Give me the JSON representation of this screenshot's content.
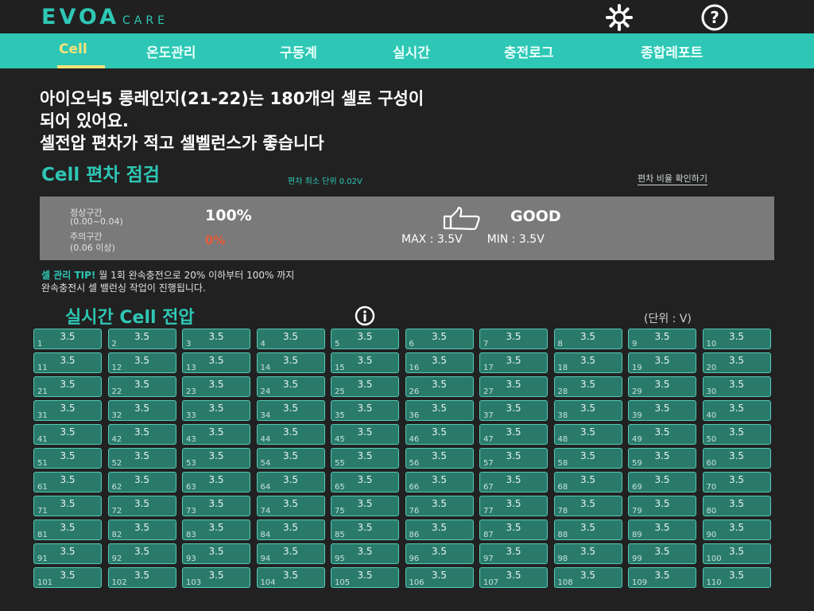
{
  "header": {
    "logo_main": "EVOA",
    "logo_sub": "CARE",
    "gear_icon": "gear-icon",
    "help_icon": "question-icon"
  },
  "tabs": [
    {
      "label": "Cell",
      "active": true
    },
    {
      "label": "온도관리",
      "active": false
    },
    {
      "label": "구동계",
      "active": false
    },
    {
      "label": "실시간",
      "active": false
    },
    {
      "label": "충전로그",
      "active": false
    },
    {
      "label": "종합레포트",
      "active": false
    }
  ],
  "summary": {
    "line1": "아이오닉5 롱레인지(21-22)는 180개의 셀로 구성이",
    "line2": "되어 있어요.",
    "line3": "셀전압 편차가 적고 셀벨런스가 좋습니다"
  },
  "deviation": {
    "title": "Cell 편차 점검",
    "subtitle": "편차 최소 단위 0.02V",
    "link": "편차 비율 확인하기",
    "normal_label_1": "정상구간",
    "normal_label_2": "(0.00~0.04)",
    "normal_value": "100%",
    "warn_label_1": "주의구간",
    "warn_label_2": "(0.06 이상)",
    "warn_value": "0%",
    "status": "GOOD",
    "max_label": "MAX : 3.5V",
    "min_label": "MIN : 3.5V"
  },
  "tip": {
    "prefix": "셀 관리 TIP!",
    "text1": " 월 1회 완속충전으로 20% 이하부터 100% 까지",
    "text2": "완속충전시 셀 밸런싱 작업이 진행됩니다."
  },
  "realtime": {
    "title": "실시간 Cell 전압",
    "unit": "(단위 : V)"
  },
  "colors": {
    "accent": "#2ec7b5",
    "background": "#212121",
    "active_tab": "#f6e27a",
    "cell": "#2a7a6c",
    "warn": "#e85a3a"
  },
  "cells": [
    {
      "n": "1",
      "v": "3.5"
    },
    {
      "n": "2",
      "v": "3.5"
    },
    {
      "n": "3",
      "v": "3.5"
    },
    {
      "n": "4",
      "v": "3.5"
    },
    {
      "n": "5",
      "v": "3.5"
    },
    {
      "n": "6",
      "v": "3.5"
    },
    {
      "n": "7",
      "v": "3.5"
    },
    {
      "n": "8",
      "v": "3.5"
    },
    {
      "n": "9",
      "v": "3.5"
    },
    {
      "n": "10",
      "v": "3.5"
    },
    {
      "n": "11",
      "v": "3.5"
    },
    {
      "n": "12",
      "v": "3.5"
    },
    {
      "n": "13",
      "v": "3.5"
    },
    {
      "n": "14",
      "v": "3.5"
    },
    {
      "n": "15",
      "v": "3.5"
    },
    {
      "n": "16",
      "v": "3.5"
    },
    {
      "n": "17",
      "v": "3.5"
    },
    {
      "n": "18",
      "v": "3.5"
    },
    {
      "n": "19",
      "v": "3.5"
    },
    {
      "n": "20",
      "v": "3.5"
    },
    {
      "n": "21",
      "v": "3.5"
    },
    {
      "n": "22",
      "v": "3.5"
    },
    {
      "n": "23",
      "v": "3.5"
    },
    {
      "n": "24",
      "v": "3.5"
    },
    {
      "n": "25",
      "v": "3.5"
    },
    {
      "n": "26",
      "v": "3.5"
    },
    {
      "n": "27",
      "v": "3.5"
    },
    {
      "n": "28",
      "v": "3.5"
    },
    {
      "n": "29",
      "v": "3.5"
    },
    {
      "n": "30",
      "v": "3.5"
    },
    {
      "n": "31",
      "v": "3.5"
    },
    {
      "n": "32",
      "v": "3.5"
    },
    {
      "n": "33",
      "v": "3.5"
    },
    {
      "n": "34",
      "v": "3.5"
    },
    {
      "n": "35",
      "v": "3.5"
    },
    {
      "n": "36",
      "v": "3.5"
    },
    {
      "n": "37",
      "v": "3.5"
    },
    {
      "n": "38",
      "v": "3.5"
    },
    {
      "n": "39",
      "v": "3.5"
    },
    {
      "n": "40",
      "v": "3.5"
    },
    {
      "n": "41",
      "v": "3.5"
    },
    {
      "n": "42",
      "v": "3.5"
    },
    {
      "n": "43",
      "v": "3.5"
    },
    {
      "n": "44",
      "v": "3.5"
    },
    {
      "n": "45",
      "v": "3.5"
    },
    {
      "n": "46",
      "v": "3.5"
    },
    {
      "n": "47",
      "v": "3.5"
    },
    {
      "n": "48",
      "v": "3.5"
    },
    {
      "n": "49",
      "v": "3.5"
    },
    {
      "n": "50",
      "v": "3.5"
    },
    {
      "n": "51",
      "v": "3.5"
    },
    {
      "n": "52",
      "v": "3.5"
    },
    {
      "n": "53",
      "v": "3.5"
    },
    {
      "n": "54",
      "v": "3.5"
    },
    {
      "n": "55",
      "v": "3.5"
    },
    {
      "n": "56",
      "v": "3.5"
    },
    {
      "n": "57",
      "v": "3.5"
    },
    {
      "n": "58",
      "v": "3.5"
    },
    {
      "n": "59",
      "v": "3.5"
    },
    {
      "n": "60",
      "v": "3.5"
    },
    {
      "n": "61",
      "v": "3.5"
    },
    {
      "n": "62",
      "v": "3.5"
    },
    {
      "n": "63",
      "v": "3.5"
    },
    {
      "n": "64",
      "v": "3.5"
    },
    {
      "n": "65",
      "v": "3.5"
    },
    {
      "n": "66",
      "v": "3.5"
    },
    {
      "n": "67",
      "v": "3.5"
    },
    {
      "n": "68",
      "v": "3.5"
    },
    {
      "n": "69",
      "v": "3.5"
    },
    {
      "n": "70",
      "v": "3.5"
    },
    {
      "n": "71",
      "v": "3.5"
    },
    {
      "n": "72",
      "v": "3.5"
    },
    {
      "n": "73",
      "v": "3.5"
    },
    {
      "n": "74",
      "v": "3.5"
    },
    {
      "n": "75",
      "v": "3.5"
    },
    {
      "n": "76",
      "v": "3.5"
    },
    {
      "n": "77",
      "v": "3.5"
    },
    {
      "n": "78",
      "v": "3.5"
    },
    {
      "n": "79",
      "v": "3.5"
    },
    {
      "n": "80",
      "v": "3.5"
    },
    {
      "n": "81",
      "v": "3.5"
    },
    {
      "n": "82",
      "v": "3.5"
    },
    {
      "n": "83",
      "v": "3.5"
    },
    {
      "n": "84",
      "v": "3.5"
    },
    {
      "n": "85",
      "v": "3.5"
    },
    {
      "n": "86",
      "v": "3.5"
    },
    {
      "n": "87",
      "v": "3.5"
    },
    {
      "n": "88",
      "v": "3.5"
    },
    {
      "n": "89",
      "v": "3.5"
    },
    {
      "n": "90",
      "v": "3.5"
    },
    {
      "n": "91",
      "v": "3.5"
    },
    {
      "n": "92",
      "v": "3.5"
    },
    {
      "n": "93",
      "v": "3.5"
    },
    {
      "n": "94",
      "v": "3.5"
    },
    {
      "n": "95",
      "v": "3.5"
    },
    {
      "n": "96",
      "v": "3.5"
    },
    {
      "n": "97",
      "v": "3.5"
    },
    {
      "n": "98",
      "v": "3.5"
    },
    {
      "n": "99",
      "v": "3.5"
    },
    {
      "n": "100",
      "v": "3.5"
    },
    {
      "n": "101",
      "v": "3.5"
    },
    {
      "n": "102",
      "v": "3.5"
    },
    {
      "n": "103",
      "v": "3.5"
    },
    {
      "n": "104",
      "v": "3.5"
    },
    {
      "n": "105",
      "v": "3.5"
    },
    {
      "n": "106",
      "v": "3.5"
    },
    {
      "n": "107",
      "v": "3.5"
    },
    {
      "n": "108",
      "v": "3.5"
    },
    {
      "n": "109",
      "v": "3.5"
    },
    {
      "n": "110",
      "v": "3.5"
    }
  ]
}
